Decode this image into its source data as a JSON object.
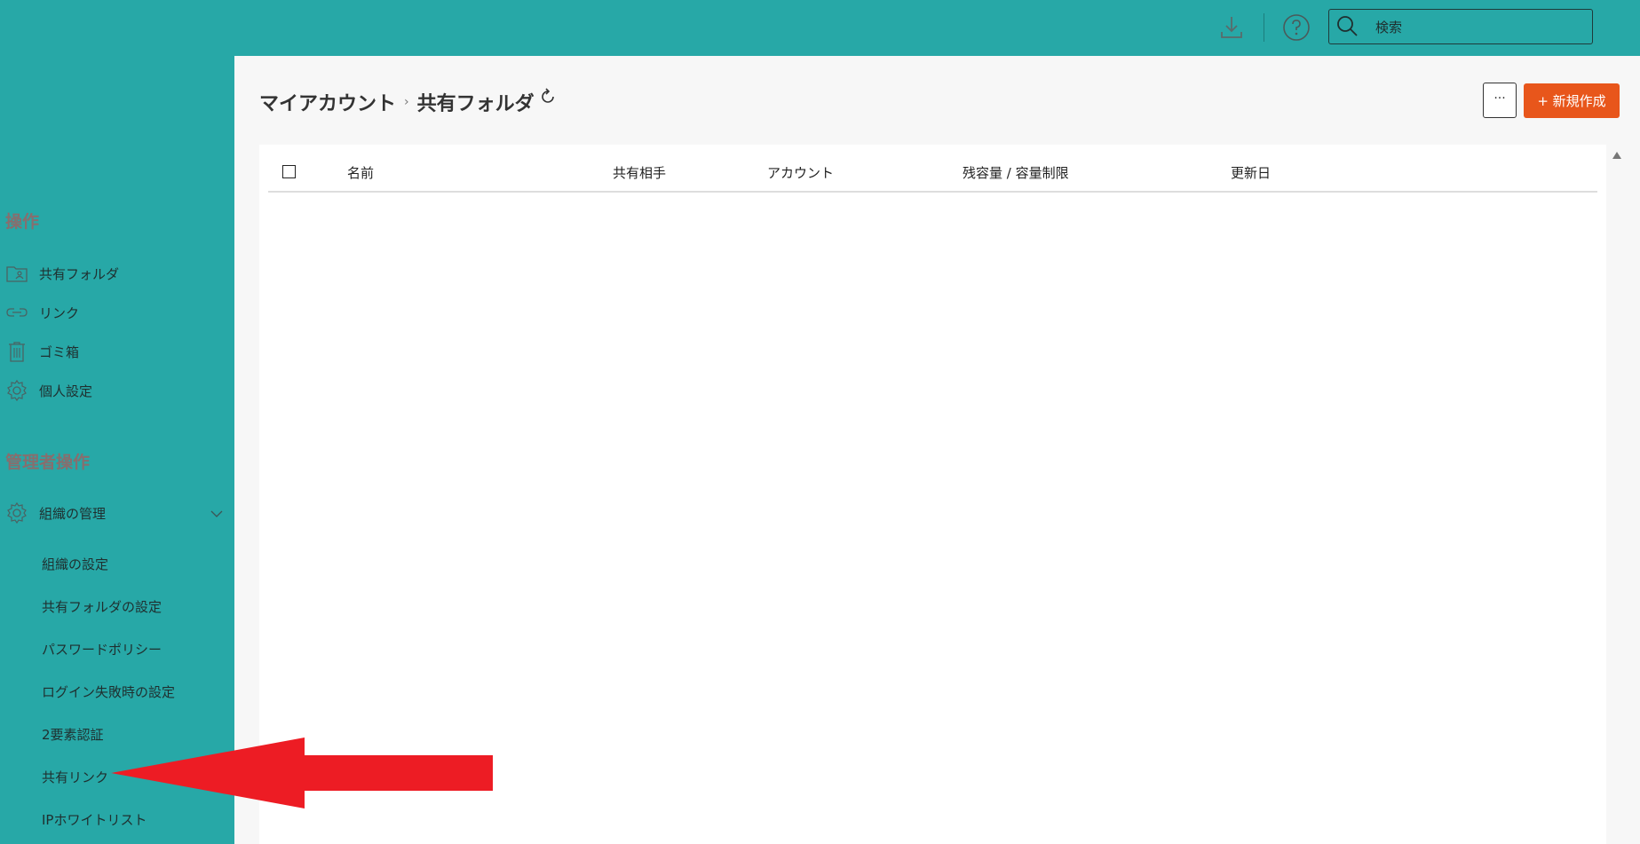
{
  "topbar": {
    "download_icon": "download-icon",
    "help_icon": "help-icon",
    "search": {
      "placeholder": "検索",
      "value": "",
      "icon": "search-icon"
    }
  },
  "sidebar": {
    "section_ops": "操作",
    "items": [
      {
        "label": "共有フォルダ",
        "icon": "shared-folder-icon"
      },
      {
        "label": "リンク",
        "icon": "link-icon"
      },
      {
        "label": "ゴミ箱",
        "icon": "trash-icon"
      },
      {
        "label": "個人設定",
        "icon": "gear-icon"
      }
    ],
    "section_admin": "管理者操作",
    "org_manage": {
      "label": "組織の管理",
      "icon": "gear-icon"
    },
    "sub_items": [
      {
        "label": "組織の設定"
      },
      {
        "label": "共有フォルダの設定"
      },
      {
        "label": "パスワードポリシー"
      },
      {
        "label": "ログイン失敗時の設定"
      },
      {
        "label": "2要素認証"
      },
      {
        "label": "共有リンク"
      },
      {
        "label": "IPホワイトリスト"
      }
    ]
  },
  "main": {
    "breadcrumb": [
      "マイアカウント",
      "共有フォルダ"
    ],
    "breadcrumb_sep": "›",
    "more_label": "···",
    "new_label": "+ 新規作成",
    "table_headers": [
      "名前",
      "共有相手",
      "アカウント",
      "残容量 / 容量制限",
      "更新日"
    ]
  },
  "colors": {
    "accent": "#27a8a7",
    "new_button": "#e8561b",
    "section_title": "#876e6e",
    "annotation_arrow": "#ed1c24"
  }
}
